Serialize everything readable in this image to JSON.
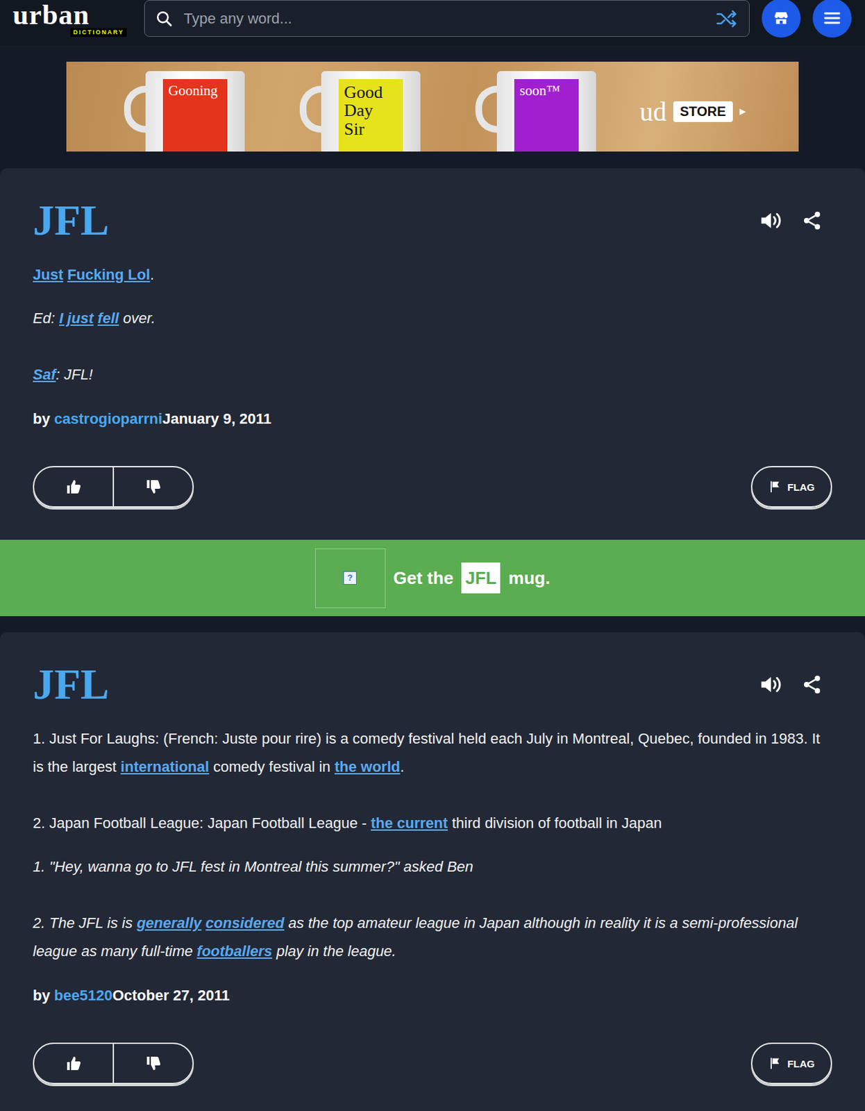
{
  "header": {
    "logo": "urban",
    "logo_tag": "DICTIONARY",
    "search": {
      "placeholder": "Type any word..."
    }
  },
  "banner": {
    "mugs": [
      {
        "label": "Gooning",
        "color": "#e5341c"
      },
      {
        "label": "Good Day Sir",
        "color": "#e6e21c"
      },
      {
        "label": "soon™",
        "color": "#a11fcf"
      }
    ],
    "brand": "ud",
    "button": "STORE",
    "button_icon": "▶"
  },
  "definitions": [
    {
      "word": "JFL",
      "meaning": [
        [
          {
            "text": "Just",
            "link": true
          },
          {
            "text": " ",
            "link": false
          },
          {
            "text": "Fucking Lol",
            "link": true
          },
          {
            "text": ".",
            "link": false
          }
        ]
      ],
      "example": [
        [
          {
            "text": "Ed: ",
            "link": false
          },
          {
            "text": "I just",
            "link": true
          },
          {
            "text": " ",
            "link": false
          },
          {
            "text": "fell",
            "link": true
          },
          {
            "text": " over.",
            "link": false
          }
        ],
        [
          {
            "text": "Saf",
            "link": true
          },
          {
            "text": ": JFL!",
            "link": false
          }
        ]
      ],
      "author": "castrogioparrni",
      "date": "January 9, 2011",
      "flag": "FLAG"
    },
    {
      "word": "JFL",
      "meaning": [
        [
          {
            "text": "1. Just For Laughs: (French: Juste pour rire) is a comedy festival held each July in Montreal, Quebec, founded in 1983. It is the largest ",
            "link": false
          },
          {
            "text": "international",
            "link": true
          },
          {
            "text": " comedy festival in ",
            "link": false
          },
          {
            "text": "the world",
            "link": true
          },
          {
            "text": ".",
            "link": false
          }
        ],
        [
          {
            "text": "2. Japan Football League: Japan Football League - ",
            "link": false
          },
          {
            "text": "the current",
            "link": true
          },
          {
            "text": " third division of football in Japan",
            "link": false
          }
        ]
      ],
      "example": [
        [
          {
            "text": "1. \"Hey, wanna go to JFL fest in Montreal this summer?\" asked Ben",
            "link": false
          }
        ],
        [
          {
            "text": "2. The JFL is is ",
            "link": false
          },
          {
            "text": "generally",
            "link": true
          },
          {
            "text": " ",
            "link": false
          },
          {
            "text": "considered",
            "link": true
          },
          {
            "text": " as the top amateur league in Japan although in reality it is a semi-professional league as many full-time ",
            "link": false
          },
          {
            "text": "footballers",
            "link": true
          },
          {
            "text": " play in the league.",
            "link": false
          }
        ]
      ],
      "author": "bee5120",
      "date": "October 27, 2011",
      "flag": "FLAG"
    }
  ],
  "promo": {
    "image_icon": "?",
    "prefix": "Get the",
    "word": "JFL",
    "suffix": "mug."
  }
}
